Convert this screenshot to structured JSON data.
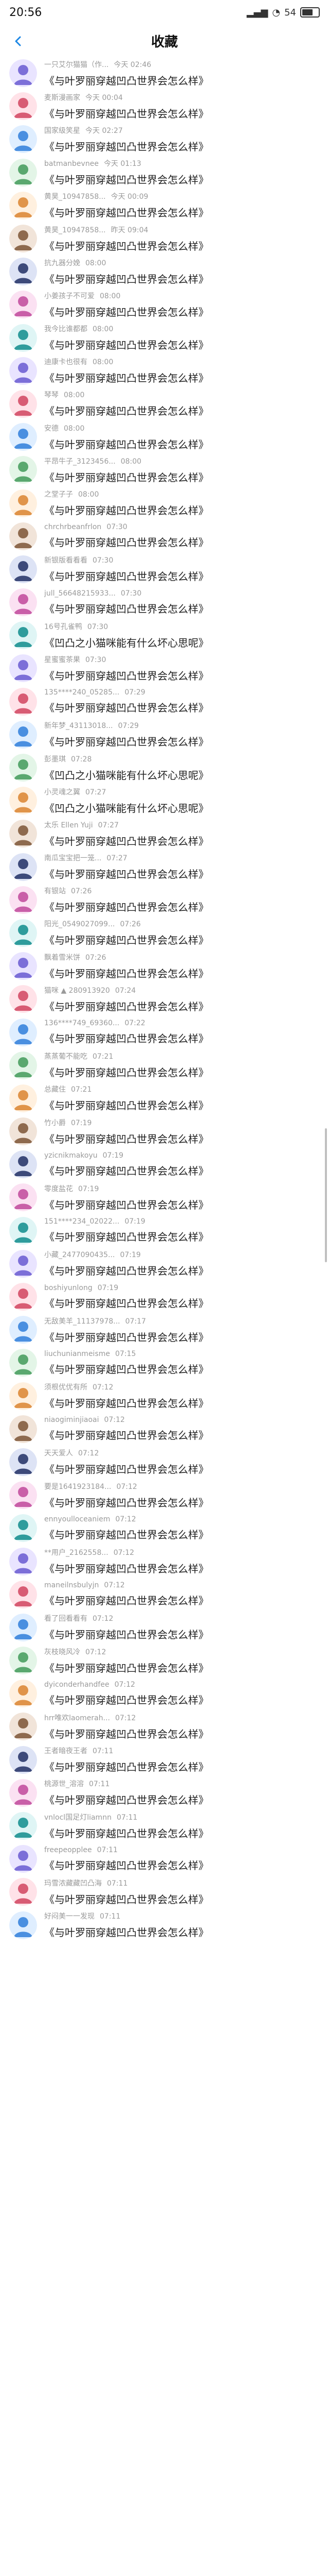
{
  "status": {
    "time": "20:56",
    "battery": "54"
  },
  "header": {
    "title": "收藏",
    "back_icon": "chevron-left-icon"
  },
  "colors": {
    "accent": "#1e88e5",
    "timestamp": "#9a9a9a",
    "default_avatar": "#c9b8ff"
  },
  "items": [
    {
      "name": "一只艾尔猫猫（作...",
      "time": "今天 02:46",
      "message": "《与叶罗丽穿越凹凸世界会怎么样》"
    },
    {
      "name": "麦斯漫画家",
      "time": "今天 00:04",
      "message": "《与叶罗丽穿越凹凸世界会怎么样》"
    },
    {
      "name": "国家级笑星",
      "time": "今天 02:27",
      "message": "《与叶罗丽穿越凹凸世界会怎么样》"
    },
    {
      "name": "batmanbevnee",
      "time": "今天 01:13",
      "message": "《与叶罗丽穿越凹凸世界会怎么样》"
    },
    {
      "name": "黄昊_10947858...",
      "time": "今天 00:09",
      "message": "《与叶罗丽穿越凹凸世界会怎么样》"
    },
    {
      "name": "黄昊_10947858...",
      "time": "昨天 09:04",
      "message": "《与叶罗丽穿越凹凸世界会怎么样》"
    },
    {
      "name": "抗九器分娩",
      "time": "08:00",
      "message": "《与叶罗丽穿越凹凸世界会怎么样》"
    },
    {
      "name": "小姜孩子不可爱",
      "time": "08:00",
      "message": "《与叶罗丽穿越凹凸世界会怎么样》"
    },
    {
      "name": "我今比谁都都",
      "time": "08:00",
      "message": "《与叶罗丽穿越凹凸世界会怎么样》"
    },
    {
      "name": "迪康卡也很有",
      "time": "08:00",
      "message": "《与叶罗丽穿越凹凸世界会怎么样》"
    },
    {
      "name": "琴琴",
      "time": "08:00",
      "message": "《与叶罗丽穿越凹凸世界会怎么样》"
    },
    {
      "name": "安德",
      "time": "08:00",
      "message": "《与叶罗丽穿越凹凸世界会怎么样》"
    },
    {
      "name": "平昂牛子_3123456...",
      "time": "08:00",
      "message": "《与叶罗丽穿越凹凸世界会怎么样》"
    },
    {
      "name": "之堂子子",
      "time": "08:00",
      "message": "《与叶罗丽穿越凹凸世界会怎么样》"
    },
    {
      "name": "chrchrbeanfrlon",
      "time": "07:30",
      "message": "《与叶罗丽穿越凹凸世界会怎么样》"
    },
    {
      "name": "新银版看看看",
      "time": "07:30",
      "message": "《与叶罗丽穿越凹凸世界会怎么样》"
    },
    {
      "name": "jull_56648215933...",
      "time": "07:30",
      "message": "《与叶罗丽穿越凹凸世界会怎么样》"
    },
    {
      "name": "16号孔雀鸭",
      "time": "07:30",
      "message": "《凹凸之小猫咪能有什么坏心思呢》"
    },
    {
      "name": "星蜜蜜茶果",
      "time": "07:30",
      "message": "《与叶罗丽穿越凹凸世界会怎么样》"
    },
    {
      "name": "135****240_05285...",
      "time": "07:29",
      "message": "《与叶罗丽穿越凹凸世界会怎么样》"
    },
    {
      "name": "新年梦_43113018...",
      "time": "07:29",
      "message": "《与叶罗丽穿越凹凸世界会怎么样》"
    },
    {
      "name": "彭墨琪",
      "time": "07:28",
      "message": "《凹凸之小猫咪能有什么坏心思呢》"
    },
    {
      "name": "小灵魂之翼",
      "time": "07:27",
      "message": "《凹凸之小猫咪能有什么坏心思呢》"
    },
    {
      "name": "太乐 Ellen Yuji",
      "time": "07:27",
      "message": "《与叶罗丽穿越凹凸世界会怎么样》"
    },
    {
      "name": "南瓜宝宝把一笼...",
      "time": "07:27",
      "message": "《与叶罗丽穿越凹凸世界会怎么样》"
    },
    {
      "name": "有银站",
      "time": "07:26",
      "message": "《与叶罗丽穿越凹凸世界会怎么样》"
    },
    {
      "name": "阳光_0549027099...",
      "time": "07:26",
      "message": "《与叶罗丽穿越凹凸世界会怎么样》"
    },
    {
      "name": "飘着雪米饼",
      "time": "07:26",
      "message": "《与叶罗丽穿越凹凸世界会怎么样》"
    },
    {
      "name": "猫咪 ▲ 280913920",
      "time": "07:24",
      "message": "《与叶罗丽穿越凹凸世界会怎么样》"
    },
    {
      "name": "136****749_69360...",
      "time": "07:22",
      "message": "《与叶罗丽穿越凹凸世界会怎么样》"
    },
    {
      "name": "蒸蒸葡不能吃",
      "time": "07:21",
      "message": "《与叶罗丽穿越凹凸世界会怎么样》"
    },
    {
      "name": "总藏住",
      "time": "07:21",
      "message": "《与叶罗丽穿越凹凸世界会怎么样》"
    },
    {
      "name": "竹小爵",
      "time": "07:19",
      "message": "《与叶罗丽穿越凹凸世界会怎么样》"
    },
    {
      "name": "yzicnikmakoyu",
      "time": "07:19",
      "message": "《与叶罗丽穿越凹凸世界会怎么样》"
    },
    {
      "name": "零度盐花",
      "time": "07:19",
      "message": "《与叶罗丽穿越凹凸世界会怎么样》"
    },
    {
      "name": "151****234_02022...",
      "time": "07:19",
      "message": "《与叶罗丽穿越凹凸世界会怎么样》"
    },
    {
      "name": "小藏_2477090435...",
      "time": "07:19",
      "message": "《与叶罗丽穿越凹凸世界会怎么样》"
    },
    {
      "name": "boshiyunlong",
      "time": "07:19",
      "message": "《与叶罗丽穿越凹凸世界会怎么样》"
    },
    {
      "name": "无敌美羊_11137978...",
      "time": "07:17",
      "message": "《与叶罗丽穿越凹凸世界会怎么样》"
    },
    {
      "name": "liuchunianmeisme",
      "time": "07:15",
      "message": "《与叶罗丽穿越凹凸世界会怎么样》"
    },
    {
      "name": "须根优优有所",
      "time": "07:12",
      "message": "《与叶罗丽穿越凹凸世界会怎么样》"
    },
    {
      "name": "niaogiminjiaoai",
      "time": "07:12",
      "message": "《与叶罗丽穿越凹凸世界会怎么样》"
    },
    {
      "name": "天天爱人",
      "time": "07:12",
      "message": "《与叶罗丽穿越凹凸世界会怎么样》"
    },
    {
      "name": "要是1641923184...",
      "time": "07:12",
      "message": "《与叶罗丽穿越凹凸世界会怎么样》"
    },
    {
      "name": "ennyoulloceaniem",
      "time": "07:12",
      "message": "《与叶罗丽穿越凹凸世界会怎么样》"
    },
    {
      "name": "**用户_2162558...",
      "time": "07:12",
      "message": "《与叶罗丽穿越凹凸世界会怎么样》"
    },
    {
      "name": "maneilnsbulyjn",
      "time": "07:12",
      "message": "《与叶罗丽穿越凹凸世界会怎么样》"
    },
    {
      "name": "看了回看看有",
      "time": "07:12",
      "message": "《与叶罗丽穿越凹凸世界会怎么样》"
    },
    {
      "name": "灰枝晓风冷",
      "time": "07:12",
      "message": "《与叶罗丽穿越凹凸世界会怎么样》"
    },
    {
      "name": "dyiconderhandfee",
      "time": "07:12",
      "message": "《与叶罗丽穿越凹凸世界会怎么样》"
    },
    {
      "name": "hrr唯欢laomerah...",
      "time": "07:12",
      "message": "《与叶罗丽穿越凹凸世界会怎么样》"
    },
    {
      "name": "王者暗夜王者",
      "time": "07:11",
      "message": "《与叶罗丽穿越凹凸世界会怎么样》"
    },
    {
      "name": "桃源世_溶溶",
      "time": "07:11",
      "message": "《与叶罗丽穿越凹凸世界会怎么样》"
    },
    {
      "name": "vnlocl国足灯liamnn",
      "time": "07:11",
      "message": "《与叶罗丽穿越凹凸世界会怎么样》"
    },
    {
      "name": "freepeopplee",
      "time": "07:11",
      "message": "《与叶罗丽穿越凹凸世界会怎么样》"
    },
    {
      "name": "玛雪浓藏藏凹凸海",
      "time": "07:11",
      "message": "《与叶罗丽穿越凹凸世界会怎么样》"
    },
    {
      "name": "好闷美一一发现",
      "time": "07:11",
      "message": "《与叶罗丽穿越凹凸世界会怎么样》"
    }
  ]
}
